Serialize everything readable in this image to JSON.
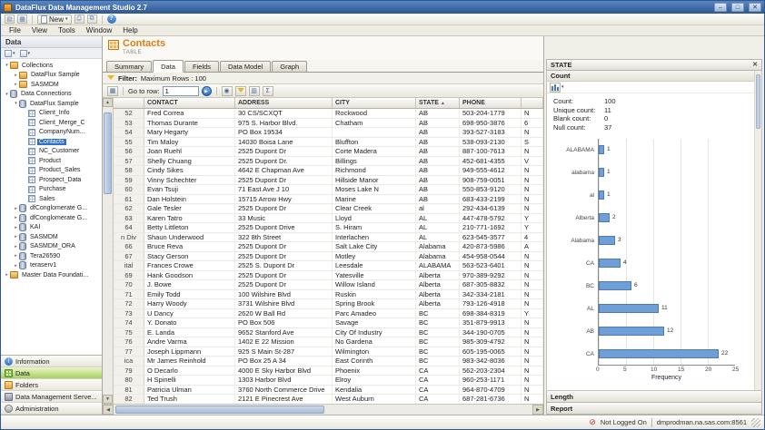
{
  "window": {
    "title": "DataFlux Data Management Studio 2.7",
    "controls": [
      {
        "name": "minimize-button",
        "glyph": "–"
      },
      {
        "name": "maximize-button",
        "glyph": "□"
      },
      {
        "name": "close-button",
        "glyph": "✕"
      }
    ]
  },
  "icons": {
    "help": "?",
    "play": "▶",
    "close": "✕",
    "sort_asc": "▲",
    "new_dropdown": "▾",
    "caret_expanded": "▾",
    "caret_collapsed": "▸",
    "find": "◉",
    "sigma": "Σ",
    "columns": "▥",
    "grid": "▦",
    "riser": "▤"
  },
  "colors": {
    "title_orange": "#e07b10",
    "selection_blue": "#2f6fc4",
    "nav_green": "#a8d060",
    "bar_blue": "#6f9fd8"
  },
  "app_toolbar": {
    "new_label": "New"
  },
  "menu": {
    "items": [
      "File",
      "View",
      "Tools",
      "Window",
      "Help"
    ]
  },
  "sidebar": {
    "title": "Data",
    "tree": [
      {
        "label": "Collections",
        "level": 0,
        "icon": "collection",
        "caret": "expanded"
      },
      {
        "label": "DataFlux Sample",
        "level": 1,
        "icon": "collection",
        "caret": "collapsed"
      },
      {
        "label": "SASMDM",
        "level": 1,
        "icon": "collection",
        "caret": "collapsed"
      },
      {
        "label": "Data Connections",
        "level": 0,
        "icon": "connections",
        "caret": "expanded"
      },
      {
        "label": "DataFlux Sample",
        "level": 1,
        "icon": "db",
        "caret": "expanded"
      },
      {
        "label": "Client_Info",
        "level": 2,
        "icon": "table",
        "caret": "none"
      },
      {
        "label": "Client_Merge_C",
        "level": 2,
        "icon": "table",
        "caret": "none"
      },
      {
        "label": "CompanyNum...",
        "level": 2,
        "icon": "table",
        "caret": "none"
      },
      {
        "label": "Contacts",
        "level": 2,
        "icon": "table",
        "caret": "none",
        "selected": true
      },
      {
        "label": "NC_Customer",
        "level": 2,
        "icon": "table",
        "caret": "none"
      },
      {
        "label": "Product",
        "level": 2,
        "icon": "table",
        "caret": "none"
      },
      {
        "label": "Product_Sales",
        "level": 2,
        "icon": "table",
        "caret": "none"
      },
      {
        "label": "Prospect_Data",
        "level": 2,
        "icon": "table",
        "caret": "none"
      },
      {
        "label": "Purchase",
        "level": 2,
        "icon": "table",
        "caret": "none"
      },
      {
        "label": "Sales",
        "level": 2,
        "icon": "table",
        "caret": "none"
      },
      {
        "label": "dfConglomerate G...",
        "level": 1,
        "icon": "db",
        "caret": "collapsed"
      },
      {
        "label": "dfConglomerate G...",
        "level": 1,
        "icon": "db",
        "caret": "collapsed"
      },
      {
        "label": "KAI",
        "level": 1,
        "icon": "db",
        "caret": "collapsed"
      },
      {
        "label": "SASMDM",
        "level": 1,
        "icon": "db",
        "caret": "collapsed"
      },
      {
        "label": "SASMDM_ORA",
        "level": 1,
        "icon": "db",
        "caret": "collapsed"
      },
      {
        "label": "Tera26590",
        "level": 1,
        "icon": "db",
        "caret": "collapsed"
      },
      {
        "label": "teraserv1",
        "level": 1,
        "icon": "db",
        "caret": "collapsed"
      },
      {
        "label": "Master Data Foundati...",
        "level": 0,
        "icon": "folder",
        "caret": "collapsed"
      }
    ],
    "nav": [
      {
        "label": "Information",
        "icon": "info"
      },
      {
        "label": "Data",
        "icon": "data",
        "selected": true
      },
      {
        "label": "Folders",
        "icon": "folder"
      },
      {
        "label": "Data Management Serve...",
        "icon": "server"
      },
      {
        "label": "Administration",
        "icon": "admin"
      }
    ]
  },
  "main": {
    "title": "Contacts",
    "subtitle": "TABLE",
    "tabs": [
      {
        "label": "Summary"
      },
      {
        "label": "Data",
        "active": true
      },
      {
        "label": "Fields"
      },
      {
        "label": "Data Model"
      },
      {
        "label": "Graph"
      }
    ],
    "filter": {
      "label": "Filter:",
      "value": "Maximum Rows : 100"
    },
    "goto": {
      "label": "Go to row:",
      "value": "1"
    },
    "grid": {
      "columns": [
        "",
        "CONTACT",
        "ADDRESS",
        "CITY",
        "STATE",
        "PHONE",
        ""
      ],
      "sort": {
        "column": "STATE",
        "direction": "asc"
      },
      "rows": [
        {
          "num": "52",
          "contact": "Fred Correa",
          "address": "30 CS/SCXQT",
          "city": "Rockwood",
          "state": "AB",
          "phone": "503-204-1779",
          "extra": "N"
        },
        {
          "num": "53",
          "contact": "Thomas Durante",
          "address": "975 S. Harbor Blvd.",
          "city": "Chatham",
          "state": "AB",
          "phone": "698-950-3876",
          "extra": "6"
        },
        {
          "num": "54",
          "contact": "Mary Hegarty",
          "address": "PO Box 19534",
          "city": "",
          "state": "AB",
          "phone": "393-527-3183",
          "extra": "N"
        },
        {
          "num": "55",
          "contact": "Tim Maloy",
          "address": "14030 Boisa Lane",
          "city": "Bluffton",
          "state": "AB",
          "phone": "538-093-2130",
          "extra": "S"
        },
        {
          "num": "56",
          "contact": "Joan Ruehl",
          "address": "2525 Dupont Dr",
          "city": "Corte Madera",
          "state": "AB",
          "phone": "887-100-7613",
          "extra": "N"
        },
        {
          "num": "57",
          "contact": "Shelly Chuang",
          "address": "2525 Dupont Dr.",
          "city": "Billings",
          "state": "AB",
          "phone": "452-681-4355",
          "extra": "V"
        },
        {
          "num": "58",
          "contact": "Cindy Sikes",
          "address": "4642 E Chapman Ave",
          "city": "Richmond",
          "state": "AB",
          "phone": "949-555-4612",
          "extra": "N"
        },
        {
          "num": "59",
          "contact": "Vinny Schechter",
          "address": "2525 Dupont Dr",
          "city": "Hillside Manor",
          "state": "AB",
          "phone": "908-759-0051",
          "extra": "N"
        },
        {
          "num": "60",
          "contact": "Evan Tsuji",
          "address": "71 East Ave J 10",
          "city": "Moses Lake N",
          "state": "AB",
          "phone": "550-853-9120",
          "extra": "N"
        },
        {
          "num": "61",
          "contact": "Dan Holstein",
          "address": "15715 Arrow Hwy",
          "city": "Marine",
          "state": "AB",
          "phone": "683-433-2199",
          "extra": "N"
        },
        {
          "num": "62",
          "contact": "Gale Tesler",
          "address": "2525 Dupont Dr",
          "city": "Clear Creek",
          "state": "al",
          "phone": "292-434-6139",
          "extra": "N"
        },
        {
          "num": "63",
          "contact": "Karen Tatro",
          "address": "33 Music",
          "city": "Lloyd",
          "state": "AL",
          "phone": "447-478-5792",
          "extra": "Y"
        },
        {
          "num": "64",
          "contact": "Betty Littleton",
          "address": "2525 Dupont Drive",
          "city": "S. Hiram",
          "state": "AL",
          "phone": "210-771-1692",
          "extra": "Y"
        },
        {
          "num": "n Div",
          "contact": "Shaun Underwood",
          "address": "322 8th Street",
          "city": "Interlachen",
          "state": "AL",
          "phone": "623-545-3577",
          "extra": "4"
        },
        {
          "num": "66",
          "contact": "Bruce Reva",
          "address": "2525 Dupont Dr",
          "city": "Salt Lake City",
          "state": "Alabama",
          "phone": "420-873-5986",
          "extra": "A"
        },
        {
          "num": "67",
          "contact": "Stacy Gerson",
          "address": "2525 Dupont Dr",
          "city": "Motley",
          "state": "Alabama",
          "phone": "454-958-0544",
          "extra": "N"
        },
        {
          "num": "ital",
          "contact": "Frances Crowe",
          "address": "2525 S. Dupont Dr",
          "city": "Leesdale",
          "state": "ALABAMA",
          "phone": "563-523-6401",
          "extra": "N"
        },
        {
          "num": "69",
          "contact": "Hank Goodson",
          "address": "2525 Dupont Dr",
          "city": "Yatesville",
          "state": "Alberta",
          "phone": "970-389-9292",
          "extra": "N"
        },
        {
          "num": "70",
          "contact": "J. Bowe",
          "address": "2525 Dupont Dr",
          "city": "Willow Island",
          "state": "Alberta",
          "phone": "687-305-8832",
          "extra": "N"
        },
        {
          "num": "71",
          "contact": "Emily Todd",
          "address": "100 Wilshire Blvd",
          "city": "Ruskin",
          "state": "Alberta",
          "phone": "342-334-2181",
          "extra": "N"
        },
        {
          "num": "72",
          "contact": "Harry Woody",
          "address": "3731 Wilshire Blvd",
          "city": "Spring Brook",
          "state": "Alberta",
          "phone": "793-126-4918",
          "extra": "N"
        },
        {
          "num": "73",
          "contact": "U Dancy",
          "address": "2620 W Ball Rd",
          "city": "Parc Amadeo",
          "state": "BC",
          "phone": "698-384-8319",
          "extra": "Y"
        },
        {
          "num": "74",
          "contact": "Y. Donato",
          "address": "PO Box 506",
          "city": "Savage",
          "state": "BC",
          "phone": "351-879-9913",
          "extra": "N"
        },
        {
          "num": "75",
          "contact": "E. Landa",
          "address": "9652 Stanford Ave",
          "city": "City Of Industry",
          "state": "BC",
          "phone": "344-190-0705",
          "extra": "N"
        },
        {
          "num": "76",
          "contact": "Andre Varma",
          "address": "1402 E 22 Mission",
          "city": "No Gardena",
          "state": "BC",
          "phone": "985-309-4792",
          "extra": "N"
        },
        {
          "num": "77",
          "contact": "Joseph Lippmann",
          "address": "925 S Main St-287",
          "city": "Wilmington",
          "state": "BC",
          "phone": "605-195-0065",
          "extra": "N"
        },
        {
          "num": "ica",
          "contact": "Mr James Reinhold",
          "address": "PO Box 25 A 34",
          "city": "East Corinth",
          "state": "BC",
          "phone": "983-342-8036",
          "extra": "N"
        },
        {
          "num": "79",
          "contact": "O Decarlo",
          "address": "4000 E Sky Harbor Blvd",
          "city": "Phoenix",
          "state": "CA",
          "phone": "562-203-2304",
          "extra": "N"
        },
        {
          "num": "80",
          "contact": "H Spinelli",
          "address": "1303 Harbor Blvd",
          "city": "Elroy",
          "state": "CA",
          "phone": "960-253-1171",
          "extra": "N"
        },
        {
          "num": "81",
          "contact": "Patricia Ulman",
          "address": "3760 North Commerce Drive",
          "city": "Kendalia",
          "state": "CA",
          "phone": "964-870-4709",
          "extra": "N"
        },
        {
          "num": "82",
          "contact": "Ted Trush",
          "address": "2121 E Pinecrest Ave",
          "city": "West Auburn",
          "state": "CA",
          "phone": "687-281-6736",
          "extra": "N"
        }
      ]
    }
  },
  "state_panel": {
    "title": "STATE",
    "section": "Count",
    "stats": [
      {
        "label": "Count:",
        "value": "100"
      },
      {
        "label": "Unique count:",
        "value": "11"
      },
      {
        "label": "Blank count:",
        "value": "0"
      },
      {
        "label": "Null count:",
        "value": "37"
      }
    ]
  },
  "chart_data": {
    "type": "bar",
    "orientation": "horizontal",
    "title": "STATE",
    "categories": [
      "ALABAMA",
      "alabama",
      "al",
      "Alberta",
      "Alabama",
      "CA",
      "BC",
      "AL",
      "AB",
      "CA"
    ],
    "values": [
      1,
      1,
      1,
      2,
      3,
      4,
      6,
      11,
      12,
      22
    ],
    "xlabel": "Frequency",
    "xlim": [
      0,
      25
    ],
    "xticks": [
      0,
      5,
      10,
      15,
      20,
      25
    ],
    "grid": true,
    "legend": false
  },
  "bottom_panels": [
    {
      "label": "Length"
    },
    {
      "label": "Report"
    }
  ],
  "status": {
    "login": "Not Logged On",
    "server": "dmprodman.na.sas.com:8561"
  }
}
